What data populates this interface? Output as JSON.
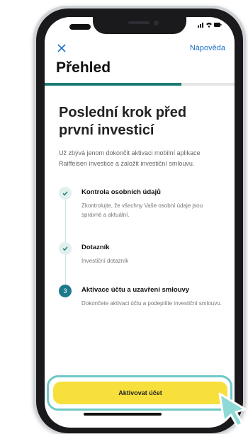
{
  "app": {
    "help_label": "Nápověda",
    "title": "Přehled",
    "progress_fraction": 0.72
  },
  "content": {
    "heading": "Poslední krok před první investicí",
    "intro": "Už zbývá jenom dokončit aktivaci mobilní aplikace Raiffeisen investice a založit investiční smlouvu."
  },
  "steps": [
    {
      "title": "Kontrola osobních údajů",
      "desc": "Zkontrolujte, že všechny Vaše osobní údaje jsou správné a aktuální.",
      "status": "done"
    },
    {
      "title": "Dotazník",
      "desc": "Investiční dotazník",
      "status": "done"
    },
    {
      "title": "Aktivace účtu a uzavření smlouvy",
      "desc": "Dokončete aktivaci účtu a podepište investiční smlouvu.",
      "status": "active",
      "number": "3"
    }
  ],
  "cta": {
    "label": "Aktivovat účet"
  },
  "colors": {
    "accent": "#1d7a73",
    "link": "#1a73c9",
    "button": "#f7e03c",
    "highlight": "#6ec9c6"
  },
  "icons": {
    "close": "close-icon",
    "check": "check-icon",
    "cursor": "pointer-cursor-icon"
  }
}
